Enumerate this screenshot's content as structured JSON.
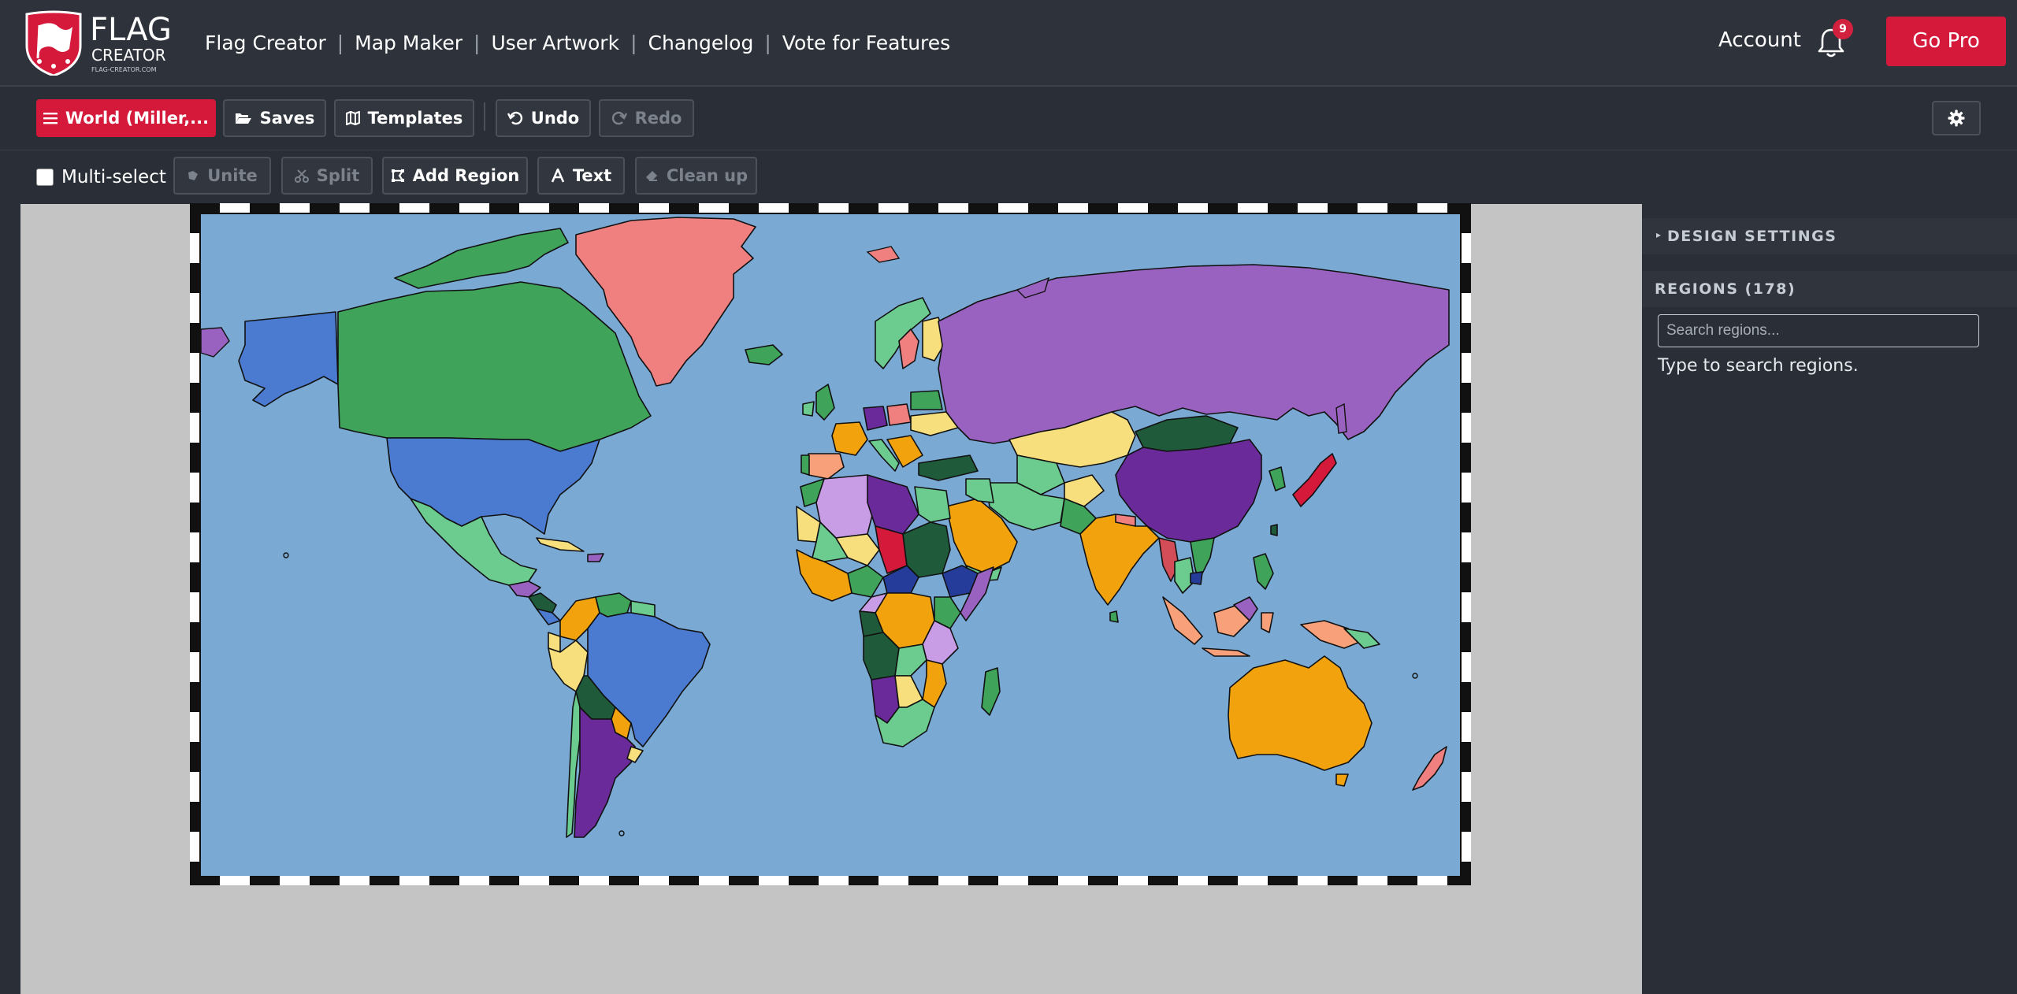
{
  "brand": {
    "line1": "FLAG",
    "line2": "CREATOR",
    "url": "FLAG-CREATOR.COM"
  },
  "nav": {
    "links": [
      "Flag Creator",
      "Map Maker",
      "User Artwork",
      "Changelog",
      "Vote for Features"
    ],
    "account": "Account",
    "notification_count": "9",
    "go_pro": "Go Pro"
  },
  "toolbar": {
    "map_menu": "World (Miller,...",
    "saves": "Saves",
    "templates": "Templates",
    "undo": "Undo",
    "redo": "Redo"
  },
  "tools": {
    "multiselect": "Multi-select",
    "unite": "Unite",
    "split": "Split",
    "add_region": "Add Region",
    "text": "Text",
    "cleanup": "Clean up"
  },
  "sidebar": {
    "design_settings": "DESIGN SETTINGS",
    "regions_header": "REGIONS (178)",
    "search_placeholder": "Search regions...",
    "search_hint": "Type to search regions."
  },
  "colors": {
    "accent": "#d4193a",
    "ocean": "#7aa9d4",
    "green": "#3fa35a",
    "blue": "#4a7bd0",
    "purple": "#9a62c0",
    "orange": "#f2a20c",
    "salmon": "#f08080",
    "yellow": "#f7df7e"
  }
}
